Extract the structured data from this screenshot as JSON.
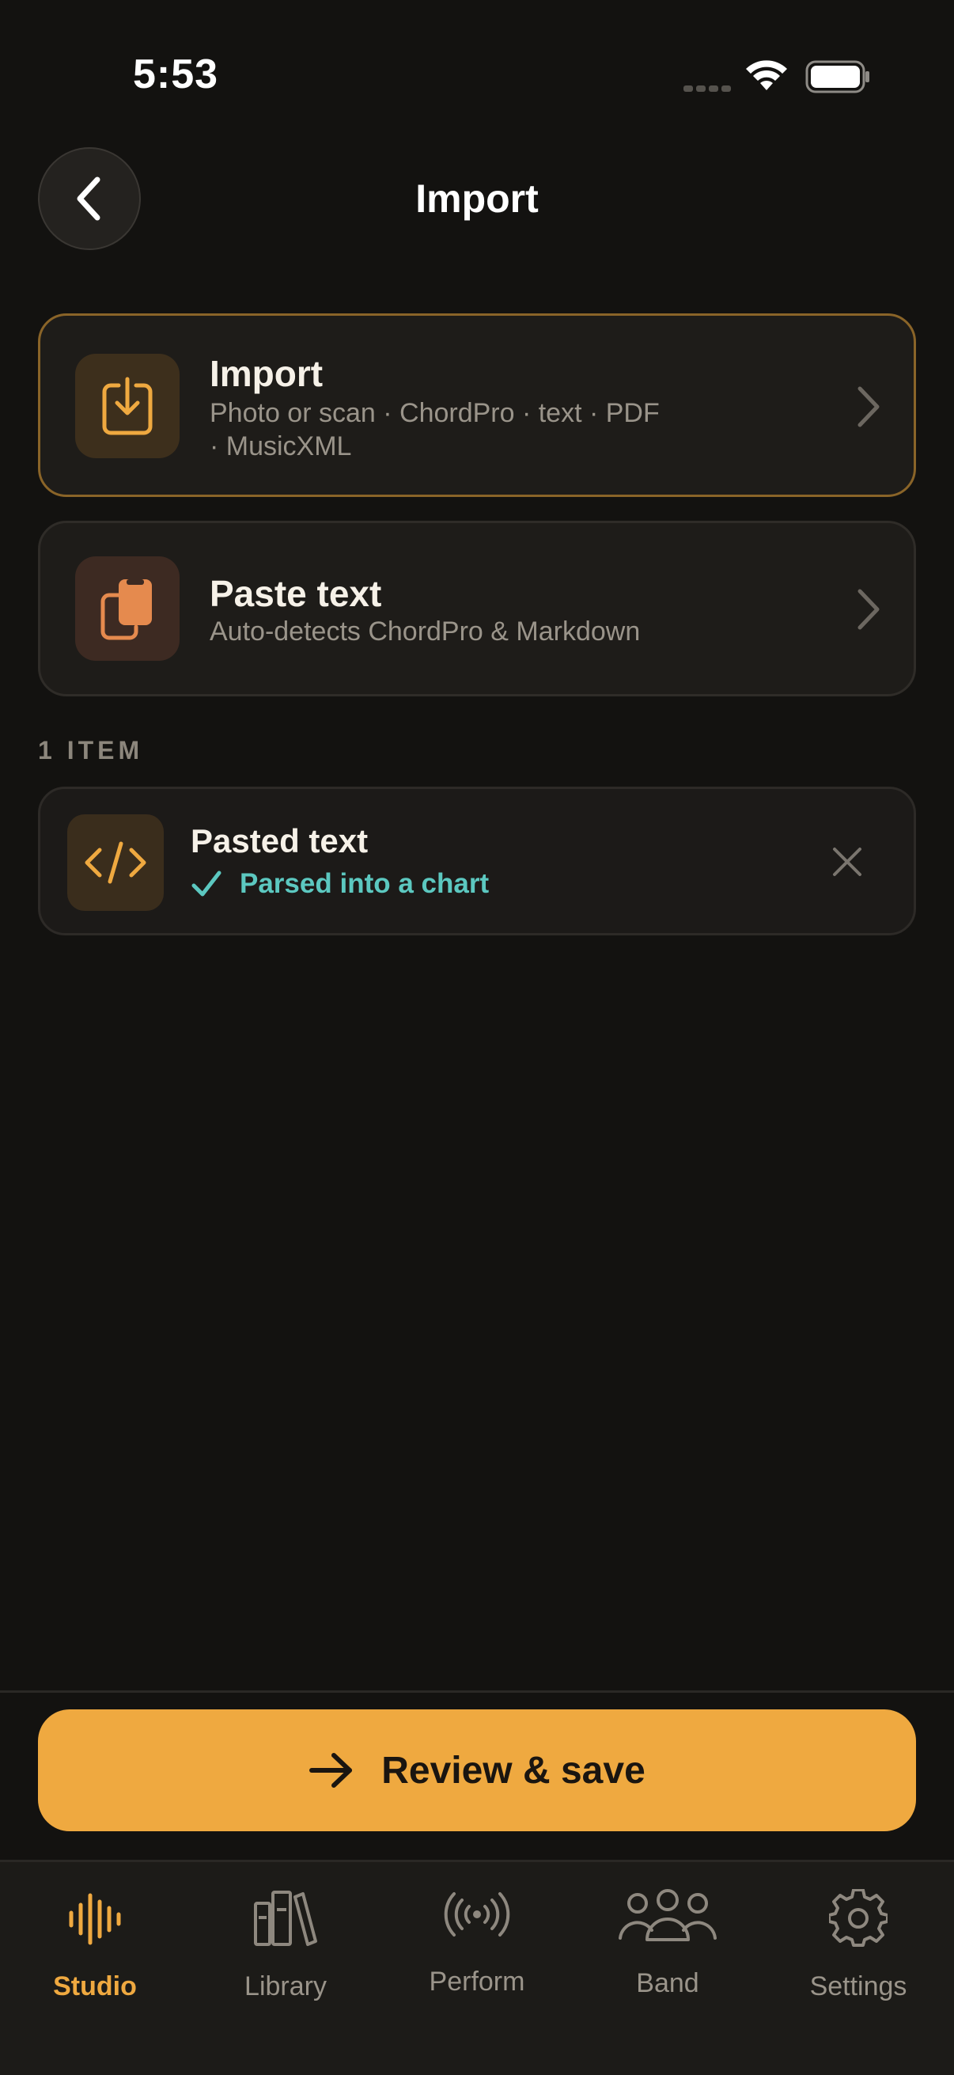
{
  "status_bar": {
    "time": "5:53"
  },
  "header": {
    "title": "Import"
  },
  "options": [
    {
      "title": "Import",
      "subtitle_line1": "Photo or scan · ChordPro · text · PDF",
      "subtitle_line2": "· MusicXML",
      "icon": "download-icon"
    },
    {
      "title": "Paste text",
      "subtitle_line1": "Auto-detects ChordPro & Markdown",
      "icon": "clipboard-icon"
    }
  ],
  "items_section": {
    "label": "1 ITEM",
    "items": [
      {
        "title": "Pasted text",
        "status": "Parsed into a chart",
        "icon": "code-icon"
      }
    ]
  },
  "primary_action": {
    "label": "Review & save",
    "icon": "arrow-right-icon"
  },
  "tabs": [
    {
      "label": "Studio",
      "icon": "waveform-icon",
      "active": true
    },
    {
      "label": "Library",
      "icon": "books-icon",
      "active": false
    },
    {
      "label": "Perform",
      "icon": "broadcast-icon",
      "active": false
    },
    {
      "label": "Band",
      "icon": "people-icon",
      "active": false
    },
    {
      "label": "Settings",
      "icon": "gear-icon",
      "active": false
    }
  ],
  "colors": {
    "accent": "#efa940",
    "background": "#131210",
    "success": "#5cc8c0",
    "import_border": "#8a6428"
  }
}
